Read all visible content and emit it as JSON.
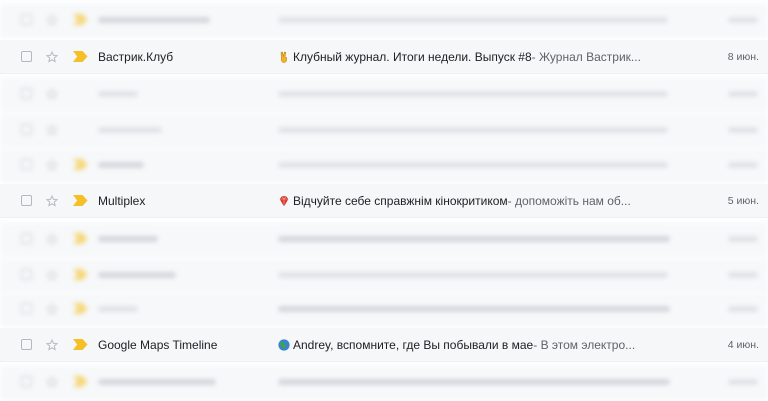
{
  "colors": {
    "row_bg": "#f6f8fa",
    "text_primary": "#202124",
    "text_secondary": "#5f6368",
    "star_outline": "#c8cbce",
    "importance_marker": "#f6bf26",
    "checkbox_border": "#c4c7ca",
    "blurred_placeholder": "#cfd3d8"
  },
  "emails": [
    {
      "sender": "Вастрик.Клуб",
      "emoji_icon": "v-hand-icon",
      "subject": "Клубный журнал. Итоги недели. Выпуск #8",
      "snippet": " - Журнал Вастрик...",
      "date": "8 июн."
    },
    {
      "sender": "Multiplex",
      "emoji_icon": "red-gem-icon",
      "subject": "Відчуйте себе справжнім кінокритиком",
      "snippet": " - допоможіть нам об...",
      "date": "5 июн."
    },
    {
      "sender": "Google Maps Timeline",
      "emoji_icon": "globe-icon",
      "subject": "Andrey, вспомните, где Вы побывали в мае",
      "snippet": " - В этом электро...",
      "date": "4 июн."
    }
  ]
}
